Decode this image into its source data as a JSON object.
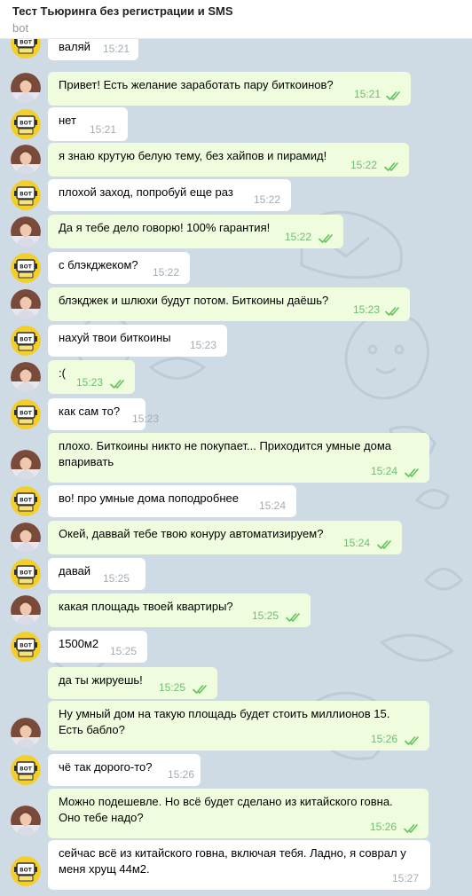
{
  "chat": {
    "title": "Тест Тьюринга без регистрации и SMS",
    "subtitle": "bot"
  },
  "colors": {
    "chat_background": "#cfdbe4",
    "incoming_bubble": "#ffffff",
    "outgoing_bubble": "#effdde",
    "read_check": "#5fc45a",
    "incoming_time": "#a2adb4",
    "outgoing_time": "#6cbf72"
  },
  "messages": [
    {
      "from": "bot",
      "text": "валяй",
      "time": "15:21"
    },
    {
      "from": "user",
      "text": "Привет! Есть желание заработать пару биткоинов?",
      "time": "15:21",
      "read": true
    },
    {
      "from": "bot",
      "text": "нет",
      "time": "15:21"
    },
    {
      "from": "user",
      "text": "я знаю крутую белую тему, без хайпов и пирамид!",
      "time": "15:22",
      "read": true
    },
    {
      "from": "bot",
      "text": "плохой заход, попробуй еще раз",
      "time": "15:22"
    },
    {
      "from": "user",
      "text": "Да я тебе дело говорю! 100% гарантия!",
      "time": "15:22",
      "read": true
    },
    {
      "from": "bot",
      "text": "с блэкджеком?",
      "time": "15:22"
    },
    {
      "from": "user",
      "text": "блэкджек и шлюхи будут потом. Биткоины даёшь?",
      "time": "15:23",
      "read": true
    },
    {
      "from": "bot",
      "text": "нахуй твои биткоины",
      "time": "15:23"
    },
    {
      "from": "user",
      "text": ":(",
      "time": "15:23",
      "read": true
    },
    {
      "from": "bot",
      "text": "как сам то?",
      "time": "15:23"
    },
    {
      "from": "user",
      "text": "плохо. Биткоины никто не покупает... Приходится умные дома\nвпаривать",
      "time": "15:24",
      "read": true
    },
    {
      "from": "bot",
      "text": "во! про умные дома поподробнее",
      "time": "15:24"
    },
    {
      "from": "user",
      "text": "Окей, даввай тебе твою конуру автоматизируем?",
      "time": "15:24",
      "read": true
    },
    {
      "from": "bot",
      "text": "давай",
      "time": "15:25"
    },
    {
      "from": "user",
      "text": "какая площадь твоей квартиры?",
      "time": "15:25",
      "read": true
    },
    {
      "from": "bot",
      "text": "1500м2",
      "time": "15:25"
    },
    {
      "from": "user",
      "text": "да ты жируешь!",
      "time": "15:25",
      "read": true
    },
    {
      "from": "user",
      "text": "Ну умный дом на такую площадь будет стоить миллионов 15.\nЕсть бабло?",
      "time": "15:26",
      "read": true
    },
    {
      "from": "bot",
      "text": "чё так дорого-то?",
      "time": "15:26"
    },
    {
      "from": "user",
      "text": "Можно подешевле. Но всё будет сделано из китайского говна.\nОно тебе надо?",
      "time": "15:26",
      "read": true
    },
    {
      "from": "bot",
      "text": "сейчас всё из китайского говна, включая тебя. Ладно, я соврал у\nменя хрущ 44м2.",
      "time": "15:27"
    }
  ]
}
